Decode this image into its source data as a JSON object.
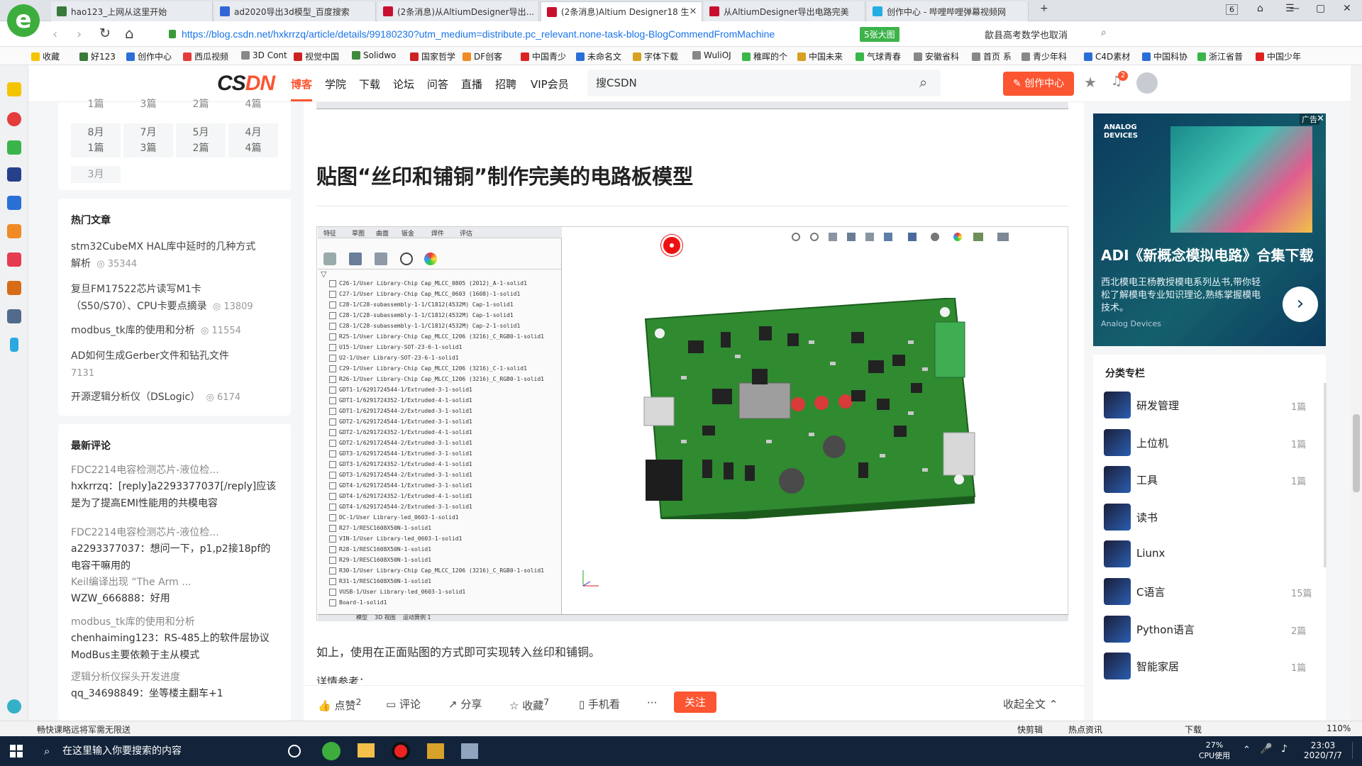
{
  "browser": {
    "tabs": [
      {
        "title": "hao123_上网从这里开始",
        "color": "#3a7a3a"
      },
      {
        "title": "ad2020导出3d模型_百度搜索",
        "color": "#3266d6"
      },
      {
        "title": "(2条消息)从AltiumDesigner导出...",
        "color": "#c8102e"
      },
      {
        "title": "(2条消息)Altium Designer18 生",
        "color": "#c8102e"
      },
      {
        "title": "从AltiumDesigner导出电路完美",
        "color": "#c8102e"
      },
      {
        "title": "创作中心 - 哔哩哔哩弹幕视频网",
        "color": "#23ade5"
      }
    ],
    "tab_count": "6",
    "new_tab": "+",
    "url": "https://blog.csdn.net/hxkrrzq/article/details/99180230?utm_medium=distribute.pc_relevant.none-task-blog-BlogCommendFromMachine",
    "zoom_badge": "5张大图",
    "search_hint": "歙县高考数学也取消",
    "nav_back": "‹",
    "nav_forward": "›",
    "reload": "↻",
    "home": "⌂",
    "bookmarks": [
      "收藏",
      "好123",
      "创作中心",
      "西瓜视频",
      "3D Cont",
      "视觉中国",
      "Solidwo",
      "国家哲学",
      "DF创客",
      "中国青少",
      "未命名文",
      "字体下载",
      "WuliOJ",
      "稚晖的个",
      "中国未来",
      "气球青春",
      "安徽省科",
      "首页 系",
      "青少年科",
      "C4D素材",
      "中国科协",
      "浙江省普",
      "中国少年"
    ]
  },
  "csdn": {
    "logo_a": "CS",
    "logo_b": "DN",
    "nav": [
      "博客",
      "学院",
      "下载",
      "论坛",
      "问答",
      "直播",
      "招聘",
      "VIP会员"
    ],
    "search_placeholder": "搜CSDN",
    "create_btn": "创作中心",
    "notify_count": "2"
  },
  "left": {
    "archive_top": [
      "1篇",
      "3篇",
      "2篇",
      "4篇"
    ],
    "archive_months": [
      {
        "m": "8月",
        "c": "1篇"
      },
      {
        "m": "7月",
        "c": "3篇"
      },
      {
        "m": "5月",
        "c": "2篇"
      },
      {
        "m": "4月",
        "c": "4篇"
      }
    ],
    "archive_last": "3月",
    "hot_title": "热门文章",
    "hot": [
      {
        "t1": "stm32CubeMX HAL库中延时的几种方式",
        "t2": "解析",
        "v": "35344"
      },
      {
        "t1": "复旦FM17522芯片读写M1卡",
        "t2": "（S50/S70）、CPU卡要点摘录",
        "v": "13809"
      },
      {
        "t1": "modbus_tk库的使用和分析",
        "t2": "",
        "v": "11554"
      },
      {
        "t1": "AD如何生成Gerber文件和钻孔文件",
        "t2": "7131",
        "v": ""
      },
      {
        "t1": "开源逻辑分析仪（DSLogic）",
        "t2": "",
        "v": "6174"
      }
    ],
    "comments_title": "最新评论",
    "comments": [
      {
        "src": "FDC2214电容检测芯片-液位检...",
        "body": "hxkrrzq：[reply]a2293377037[/reply]应该是为了提高EMI性能用的共模电容"
      },
      {
        "src": "FDC2214电容检测芯片-液位检...",
        "body": "a2293377037：想问一下，p1,p2接18pf的电容干嘛用的"
      },
      {
        "src": "Keil编译出现 “The Arm ...",
        "body": "WZW_666888：好用"
      },
      {
        "src": "modbus_tk库的使用和分析",
        "body": "chenhaiming123：RS-485上的软件层协议ModBus主要依赖于主从模式"
      },
      {
        "src": "逻辑分析仪探头开发进度",
        "body": "qq_34698849：坐等楼主翻车+1"
      }
    ]
  },
  "article": {
    "heading": "贴图“丝印和铺铜”制作完美的电路板模型",
    "after_text": "如上，使用在正面贴图的方式即可实现转入丝印和铺铜。",
    "cut_text": "详情参考：",
    "cad": {
      "top_tabs": [
        "特征",
        "草图",
        "曲面",
        "钣金",
        "焊件",
        "评估"
      ],
      "bottom_tabs": [
        "模型",
        "3D 视图",
        "运动算例 1"
      ],
      "tree": [
        "C26-1/User Library-Chip Cap_MLCC_0805 (2012)_A-1-solid1",
        "C27-1/User Library-Chip Cap_MLCC_0603 (1608)-1-solid1",
        "C28-1/C28-subassembly-1-1/C1812(4532M) Cap-1-solid1",
        "C28-1/C28-subassembly-1-1/C1812(4532M) Cap-1-solid1",
        "C28-1/C28-subassembly-1-1/C1812(4532M) Cap-2-1-solid1",
        "R25-1/User Library-Chip Cap_MLCC_1206 (3216)_C_RGB0-1-solid1",
        "U15-1/User Library-SOT-23-6-1-solid1",
        "U2-1/User Library-SOT-23-6-1-solid1",
        "C29-1/User Library-Chip Cap_MLCC_1206 (3216)_C-1-solid1",
        "R26-1/User Library-Chip Cap_MLCC_1206 (3216)_C_RGB0-1-solid1",
        "GDT1-1/6291724544-1/Extruded-3-1-solid1",
        "GDT1-1/6291724352-1/Extruded-4-1-solid1",
        "GDT1-1/6291724544-2/Extruded-3-1-solid1",
        "GDT2-1/6291724544-1/Extruded-3-1-solid1",
        "GDT2-1/6291724352-1/Extruded-4-1-solid1",
        "GDT2-1/6291724544-2/Extruded-3-1-solid1",
        "GDT3-1/6291724544-1/Extruded-3-1-solid1",
        "GDT3-1/6291724352-1/Extruded-4-1-solid1",
        "GDT3-1/6291724544-2/Extruded-3-1-solid1",
        "GDT4-1/6291724544-1/Extruded-3-1-solid1",
        "GDT4-1/6291724352-1/Extruded-4-1-solid1",
        "GDT4-1/6291724544-2/Extruded-3-1-solid1",
        "DC-1/User Library-led_0603-1-solid1",
        "R27-1/RESC1608X50N-1-solid1",
        "VIN-1/User Library-led_0603-1-solid1",
        "R28-1/RESC1608X50N-1-solid1",
        "R29-1/RESC1608X50N-1-solid1",
        "R30-1/User Library-Chip Cap_MLCC_1206 (3216)_C_RGB0-1-solid1",
        "R31-1/RESC1608X50N-1-solid1",
        "VUSB-1/User Library-led_0603-1-solid1",
        "Board-1-solid1"
      ]
    }
  },
  "actions": {
    "like": "点赞",
    "like_count": "2",
    "comment": "评论",
    "share": "分享",
    "collect": "收藏",
    "collect_count": "7",
    "mobile": "手机看",
    "more": "···",
    "follow": "关注",
    "collapse": "收起全文"
  },
  "right": {
    "ad_label": "广告",
    "ad_brand": "ANALOG DEVICES",
    "ad_title": "ADI《新概念模拟电路》合集下载",
    "ad_desc": "西北模电王杨教授模电系列丛书,带你轻松了解模电专业知识理论,熟练掌握模电技术。",
    "ad_src": "Analog Devices",
    "cat_title": "分类专栏",
    "categories": [
      {
        "name": "研发管理",
        "count": "1篇"
      },
      {
        "name": "上位机",
        "count": "1篇"
      },
      {
        "name": "工具",
        "count": "1篇"
      },
      {
        "name": "读书",
        "count": ""
      },
      {
        "name": "Liunx",
        "count": ""
      },
      {
        "name": "C语言",
        "count": "15篇"
      },
      {
        "name": "Python语言",
        "count": "2篇"
      },
      {
        "name": "智能家居",
        "count": "1篇"
      }
    ]
  },
  "statusbar": {
    "left": "畅快课略远将军需无限送",
    "items": [
      "快剪辑",
      "热点资讯",
      "下载",
      "110%"
    ]
  },
  "taskbar": {
    "search": "在这里输入你要搜索的内容",
    "cpu_pct": "27%",
    "cpu_label": "CPU使用",
    "time": "23:03",
    "date": "2020/7/7"
  }
}
